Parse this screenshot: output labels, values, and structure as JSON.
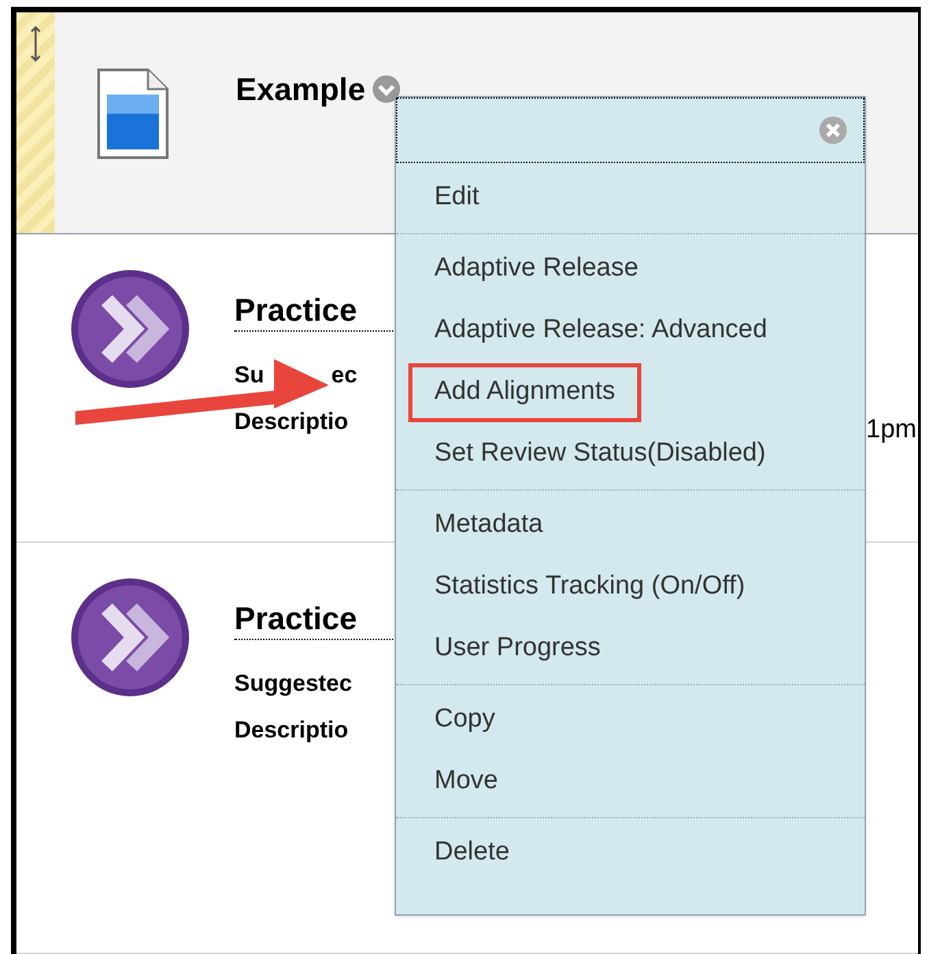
{
  "header_item": {
    "title": "Example"
  },
  "items": [
    {
      "title": "Practice",
      "line_1": [
        "Su",
        "ec"
      ],
      "line_2": "Descriptio",
      "trailing": "1pm"
    },
    {
      "title": "Practice",
      "line_1": [
        "Suggestec"
      ],
      "line_2": "Descriptio"
    }
  ],
  "menu": {
    "groups": [
      [
        {
          "label": "Edit",
          "highlighted": false
        }
      ],
      [
        {
          "label": "Adaptive Release",
          "highlighted": false
        },
        {
          "label": "Adaptive Release: Advanced",
          "highlighted": false
        },
        {
          "label": "Add Alignments",
          "highlighted": true
        },
        {
          "label": "Set Review Status(Disabled)",
          "highlighted": false
        }
      ],
      [
        {
          "label": "Metadata",
          "highlighted": false
        },
        {
          "label": "Statistics Tracking (On/Off)",
          "highlighted": false
        },
        {
          "label": "User Progress",
          "highlighted": false
        }
      ],
      [
        {
          "label": "Copy",
          "highlighted": false
        },
        {
          "label": "Move",
          "highlighted": false
        }
      ],
      [
        {
          "label": "Delete",
          "highlighted": false
        }
      ]
    ]
  }
}
